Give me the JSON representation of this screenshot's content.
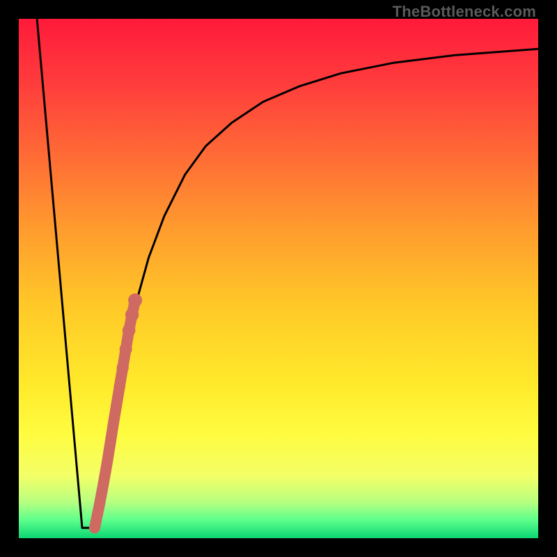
{
  "watermark": "TheBottleneck.com",
  "colors": {
    "frame": "#000000",
    "curve": "#000000",
    "markers": "#cf6a62",
    "gradient_stops": [
      "#ff1a3a",
      "#ff3b3c",
      "#ff6a36",
      "#ff9a2e",
      "#ffc828",
      "#ffe92a",
      "#fffc40",
      "#f3ff67",
      "#b8ff80",
      "#5dff8c",
      "#0cd673"
    ]
  },
  "chart_data": {
    "type": "line",
    "title": "",
    "xlabel": "",
    "ylabel": "",
    "xlim": [
      0,
      100
    ],
    "ylim": [
      0,
      100
    ],
    "series": [
      {
        "name": "left-line",
        "x": [
          3.5,
          12.2
        ],
        "y": [
          100,
          2
        ]
      },
      {
        "name": "floor",
        "x": [
          12.2,
          14.6
        ],
        "y": [
          2,
          2
        ]
      },
      {
        "name": "right-curve",
        "x": [
          14.6,
          16,
          18,
          20,
          22.5,
          25,
          28,
          32,
          36,
          41,
          47,
          54,
          62,
          72,
          84,
          100
        ],
        "y": [
          2,
          10,
          22,
          34,
          45,
          54,
          62,
          70,
          75.5,
          80,
          84,
          87,
          89.5,
          91.5,
          93,
          94.2
        ]
      }
    ],
    "markers": {
      "name": "highlight-segment",
      "x": [
        14.6,
        15.4,
        16.2,
        17.0,
        17.6,
        18.2,
        18.8,
        19.4,
        20.0,
        20.6,
        21.2,
        21.8,
        22.4
      ],
      "y": [
        2.0,
        5.8,
        10.0,
        14.5,
        18.2,
        22.0,
        25.6,
        29.2,
        32.8,
        36.4,
        40.0,
        43.0,
        45.8
      ]
    }
  }
}
